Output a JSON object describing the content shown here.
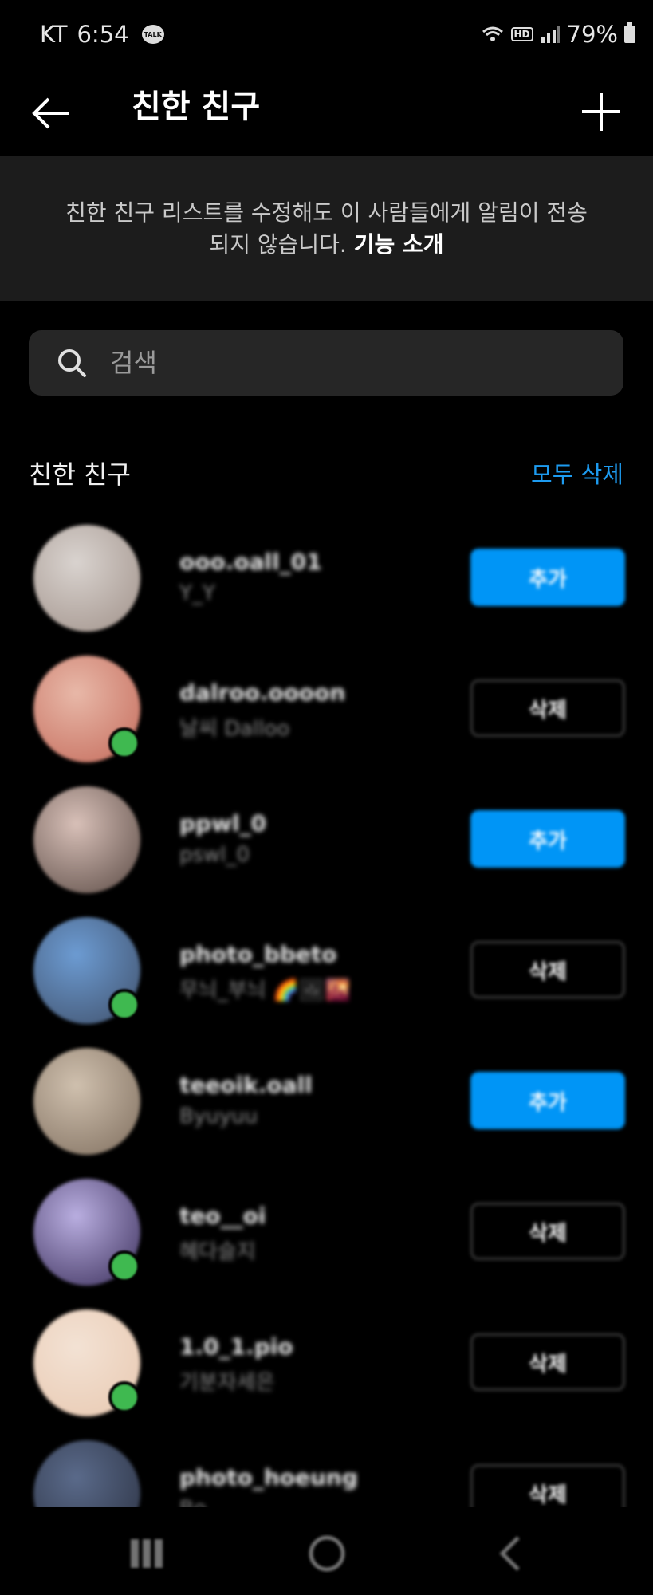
{
  "status_bar": {
    "carrier": "KT",
    "time": "6:54",
    "talk_badge": "TALK",
    "hd_badge": "HD",
    "battery": "79%"
  },
  "header": {
    "title": "친한 친구"
  },
  "notice": {
    "text": "친한 친구 리스트를 수정해도 이 사람들에게 알림이 전송되지 않습니다.",
    "link": "기능 소개"
  },
  "search": {
    "placeholder": "검색"
  },
  "section": {
    "title": "친한 친구",
    "remove_all": "모두 삭제"
  },
  "friends": [
    {
      "username": "ooo.oall_01",
      "fullname": "Y_Y",
      "action": "추가",
      "action_type": "add",
      "online": false,
      "avatar_colors": [
        "#d9d3cf",
        "#a09189"
      ]
    },
    {
      "username": "dalroo.oooon",
      "fullname": "날씨 Dalloo",
      "action": "삭제",
      "action_type": "remove",
      "online": true,
      "avatar_colors": [
        "#e8b8a8",
        "#c46a5a"
      ]
    },
    {
      "username": "ppwl_0",
      "fullname": "pswl_0",
      "action": "추가",
      "action_type": "add",
      "online": false,
      "avatar_colors": [
        "#d8c0b8",
        "#5a4a44"
      ]
    },
    {
      "username": "photo_bbeto",
      "fullname": "무늬_부늬 🌈🖼🌇",
      "action": "삭제",
      "action_type": "remove",
      "online": true,
      "avatar_colors": [
        "#6c9bd2",
        "#40506a"
      ]
    },
    {
      "username": "teeoik.oall",
      "fullname": "Byuyuu",
      "action": "추가",
      "action_type": "add",
      "online": false,
      "avatar_colors": [
        "#cfc0ae",
        "#7f6e5e"
      ]
    },
    {
      "username": "teo__oi",
      "fullname": "혜다슬지",
      "action": "삭제",
      "action_type": "remove",
      "online": true,
      "avatar_colors": [
        "#b9aee0",
        "#3a2e5a"
      ]
    },
    {
      "username": "1.0_1.pio",
      "fullname": "기분자세은",
      "action": "삭제",
      "action_type": "remove",
      "online": true,
      "avatar_colors": [
        "#f3e2d4",
        "#e8c8b0"
      ]
    },
    {
      "username": "photo_hoeung",
      "fullname": "Bo___",
      "action": "삭제",
      "action_type": "remove",
      "online": false,
      "avatar_colors": [
        "#5a6a8a",
        "#2a3040"
      ]
    }
  ]
}
